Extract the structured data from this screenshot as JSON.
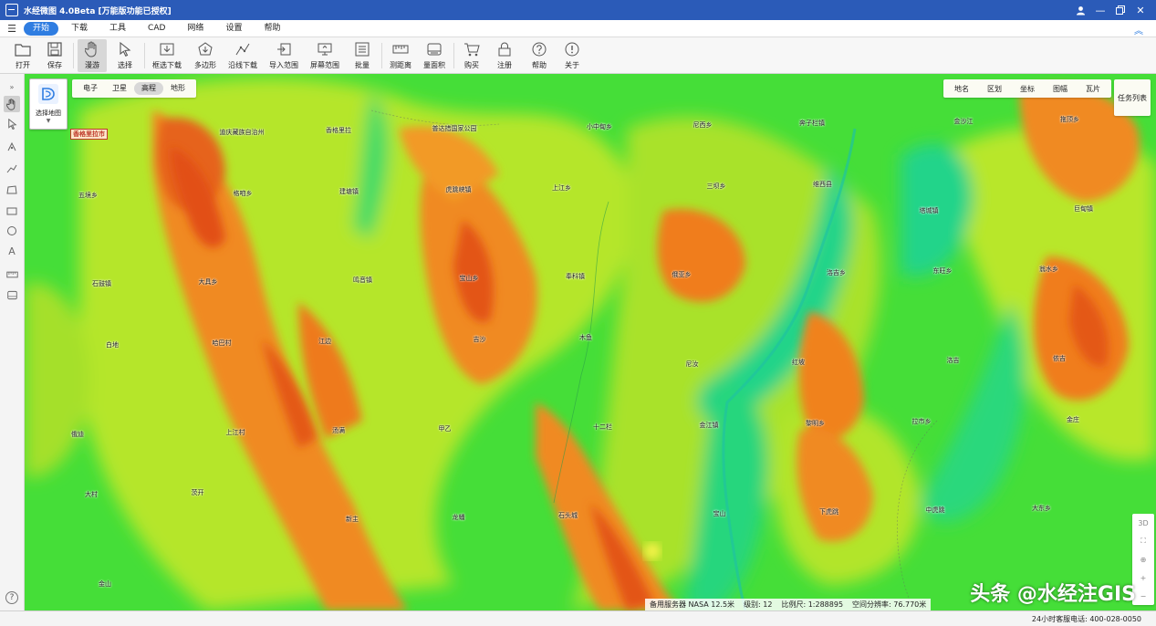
{
  "window": {
    "title": "水经微图 4.0Beta [万能版功能已授权]",
    "controls": [
      "user-icon",
      "minimize-icon",
      "restore-icon",
      "close-icon"
    ]
  },
  "menu": {
    "items": [
      "开始",
      "下载",
      "工具",
      "CAD",
      "网络",
      "设置",
      "帮助"
    ],
    "active": "开始"
  },
  "toolbar": {
    "open": "打开",
    "save": "保存",
    "pan": "漫游",
    "select": "选择",
    "box_download": "框选下载",
    "polygon": "多边形",
    "line_download": "沿线下载",
    "import_range": "导入范围",
    "screen_range": "屏幕范围",
    "batch": "批量",
    "measure_distance": "测距离",
    "measure_area": "量面积",
    "buy": "购买",
    "register": "注册",
    "help": "帮助",
    "about": "关于"
  },
  "map_select": {
    "label": "选择地图"
  },
  "basemap_tabs": {
    "electronic": "电子",
    "satellite": "卫星",
    "elevation": "高程",
    "terrain": "地形",
    "active": "高程"
  },
  "layer_tabs": {
    "placename": "地名",
    "district": "区划",
    "coords": "坐标",
    "sheet": "图幅",
    "tiles": "瓦片"
  },
  "task_list": "任务列表",
  "map_controls": {
    "three_d": "3D"
  },
  "status": {
    "server": "备用服务器 NASA 12.5米",
    "level": "级别: 12",
    "scale": "比例尺: 1:288895",
    "resolution": "空间分辨率: 76.770米"
  },
  "watermark": "头条 @水经注GIS",
  "hotline": "24小时客服电话: 400-028-0050",
  "help_glyph": "?",
  "map_labels": [
    "香格里拉市",
    "迪庆藏族自治州",
    "香格里拉",
    "普达措国家公园",
    "小中甸乡",
    "尼西乡",
    "奔子栏镇",
    "金沙江",
    "拖顶乡",
    "五境乡",
    "格咱乡",
    "建塘镇",
    "虎跳峡镇",
    "上江乡",
    "三坝乡",
    "维西县",
    "塔城镇",
    "巨甸镇",
    "石鼓镇",
    "大具乡",
    "鸣音镇",
    "宝山乡",
    "奉科镇",
    "俄亚乡",
    "洛吉乡",
    "东旺乡",
    "翁水乡",
    "白地",
    "哈巴村",
    "江边",
    "吉沙",
    "木鱼",
    "尼汝",
    "红坡",
    "洛吉",
    "依吉",
    "俄迪",
    "上江村",
    "汤满",
    "甲乙",
    "十二栏",
    "金江镇",
    "黎明乡",
    "拉市乡",
    "金庄",
    "大村",
    "茨开",
    "新主",
    "龙蟠",
    "石头城",
    "宝山",
    "下虎跳",
    "中虎跳",
    "大东乡",
    "金山"
  ]
}
